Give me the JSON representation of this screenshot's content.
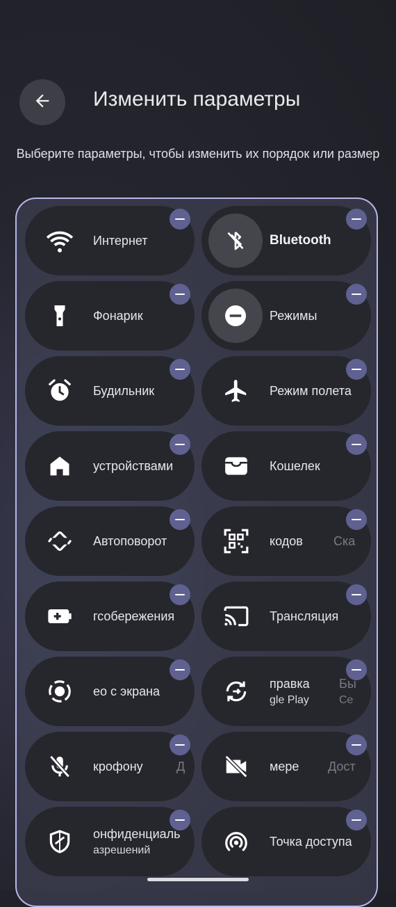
{
  "header": {
    "back_icon": "arrow-left-icon",
    "title": "Изменить параметры",
    "subtitle": "Выберите параметры, чтобы изменить их порядок или размер"
  },
  "tiles": [
    {
      "label": "Интернет",
      "icon": "wifi-icon"
    },
    {
      "label": "Bluetooth",
      "icon": "bluetooth-off-icon"
    },
    {
      "label": "Фонарик",
      "icon": "flashlight-icon"
    },
    {
      "label": "Режимы",
      "icon": "modes-icon"
    },
    {
      "label": "Будильник",
      "icon": "alarm-icon"
    },
    {
      "label": "Режим полета",
      "icon": "airplane-icon"
    },
    {
      "label": "устройствами",
      "icon": "home-icon"
    },
    {
      "label": "Кошелек",
      "icon": "wallet-icon"
    },
    {
      "label": "кодов",
      "extra": "Ска",
      "icon": "qr-scanner-icon"
    },
    {
      "label": "Автоповорот",
      "icon": "autorotate-icon"
    },
    {
      "label": "гсобережения",
      "icon": "battery-saver-icon"
    },
    {
      "label": "Трансляция",
      "icon": "cast-icon"
    },
    {
      "label": "ео с экрана",
      "icon": "screen-record-icon"
    },
    {
      "label": "правка",
      "sub": "gle Play",
      "extra": "Бы",
      "extra_sub": "Се",
      "icon": "quick-share-icon"
    },
    {
      "label": "крофону",
      "extra": "Д",
      "icon": "mic-off-icon"
    },
    {
      "label": "мере",
      "extra": "Дост",
      "icon": "camera-off-icon"
    },
    {
      "label": "онфиденциаль",
      "sub": "азрешений",
      "icon": "privacy-shield-icon"
    },
    {
      "label": "Точка доступа",
      "icon": "hotspot-icon"
    }
  ]
}
